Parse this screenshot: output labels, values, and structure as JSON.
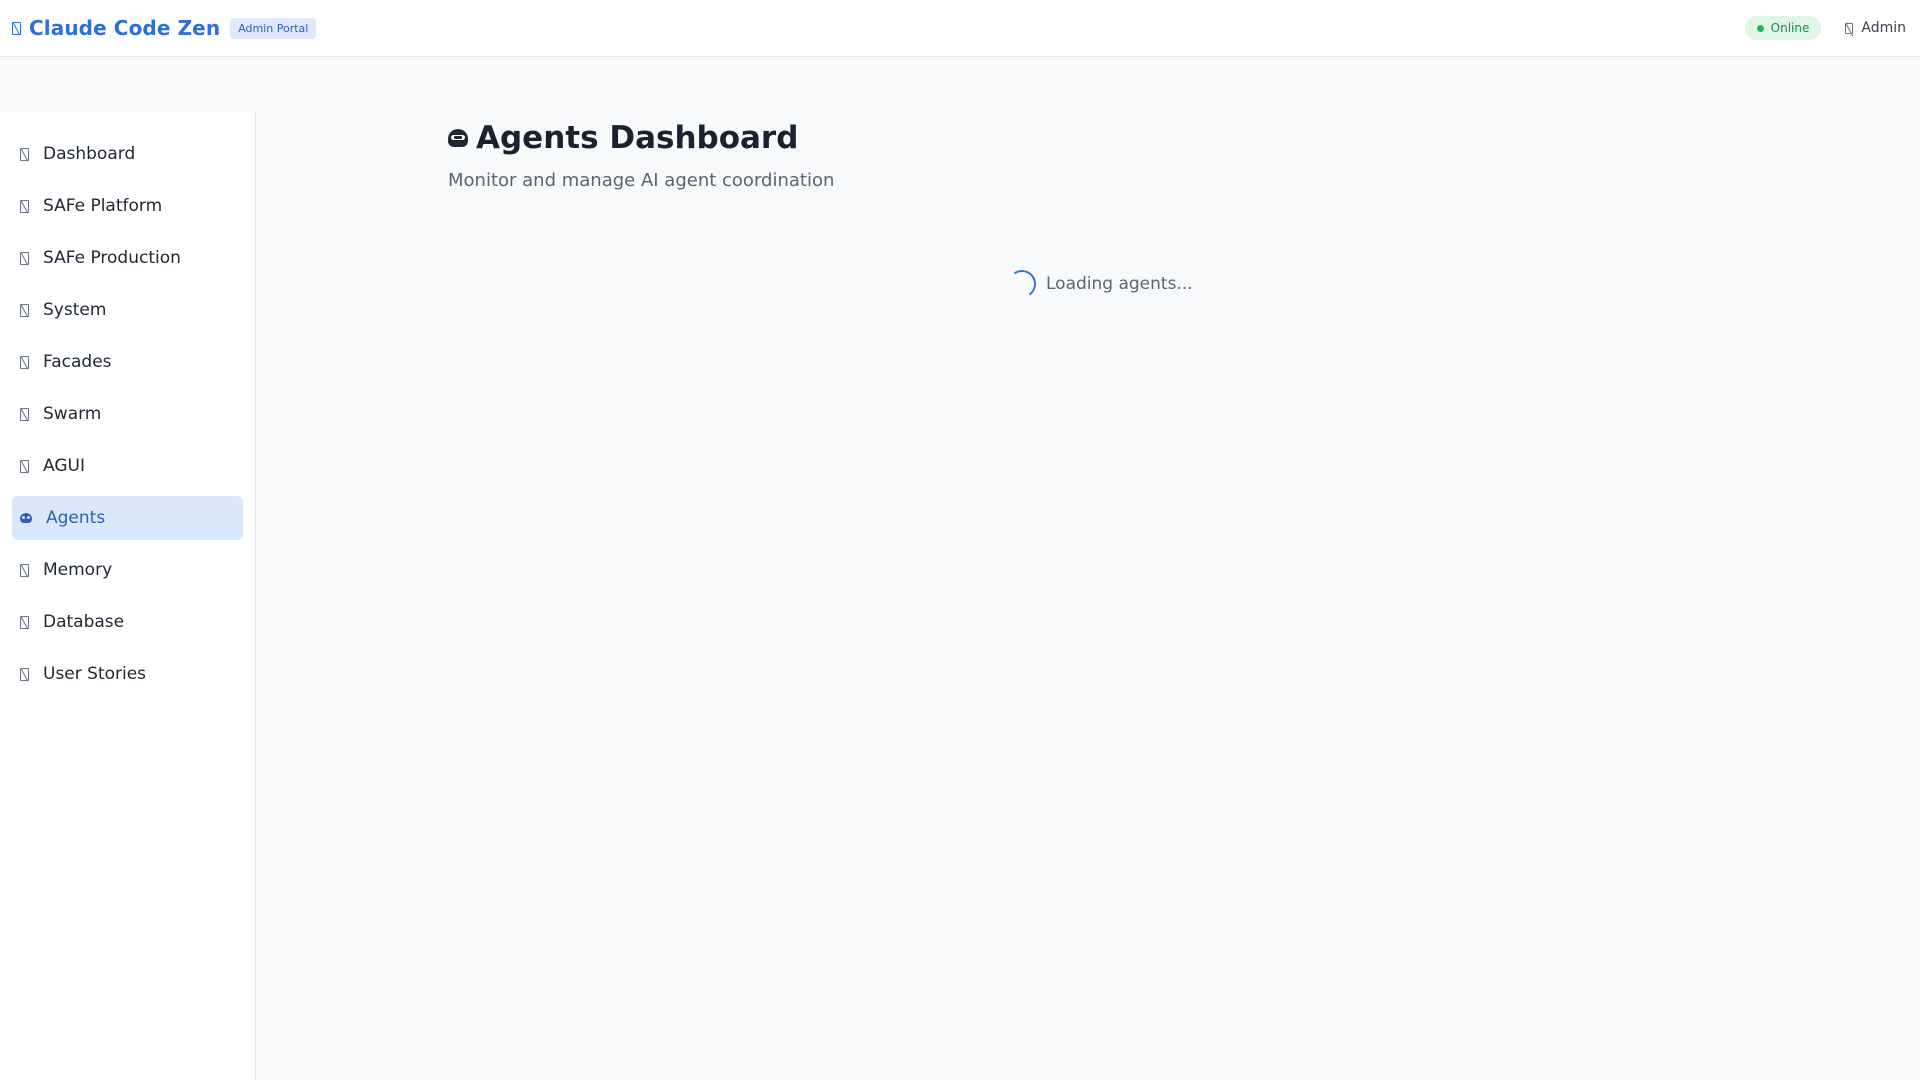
{
  "header": {
    "brand_icon": "logo-icon",
    "app_title": "Claude Code Zen",
    "badge": "Admin Portal",
    "status": {
      "label": "Online",
      "color": "#22b35a"
    },
    "user": {
      "icon": "user-icon",
      "label": "Admin"
    }
  },
  "sidebar": {
    "items": [
      {
        "label": "Dashboard",
        "icon": "dashboard-icon",
        "active": false
      },
      {
        "label": "SAFe Platform",
        "icon": "platform-icon",
        "active": false
      },
      {
        "label": "SAFe Production",
        "icon": "production-icon",
        "active": false
      },
      {
        "label": "System",
        "icon": "system-icon",
        "active": false
      },
      {
        "label": "Facades",
        "icon": "facades-icon",
        "active": false
      },
      {
        "label": "Swarm",
        "icon": "swarm-icon",
        "active": false
      },
      {
        "label": "AGUI",
        "icon": "agui-icon",
        "active": false
      },
      {
        "label": "Agents",
        "icon": "robot-icon",
        "active": true
      },
      {
        "label": "Memory",
        "icon": "memory-icon",
        "active": false
      },
      {
        "label": "Database",
        "icon": "database-icon",
        "active": false
      },
      {
        "label": "User Stories",
        "icon": "user-stories-icon",
        "active": false
      }
    ]
  },
  "main": {
    "title_icon": "robot-icon",
    "title": "Agents Dashboard",
    "subtitle": "Monitor and manage AI agent coordination",
    "loading_text": "Loading agents..."
  },
  "colors": {
    "accent": "#2f6fd6",
    "active_bg": "#dbe7fb",
    "online_bg": "#dff5e6"
  }
}
